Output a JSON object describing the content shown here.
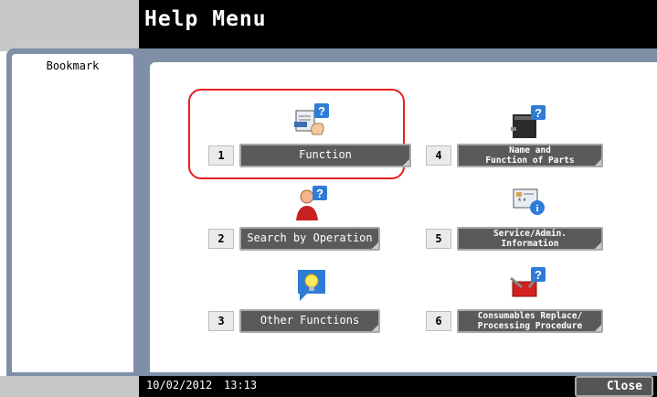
{
  "header": {
    "title": "Help Menu"
  },
  "sidebar": {
    "label": "Bookmark"
  },
  "items": [
    {
      "number": "1",
      "label": "Function",
      "icon": "function-help-icon"
    },
    {
      "number": "2",
      "label": "Search by Operation",
      "icon": "operator-help-icon"
    },
    {
      "number": "3",
      "label": "Other Functions",
      "icon": "lightbulb-help-icon"
    },
    {
      "number": "4",
      "line1": "Name and",
      "line2": "Function of Parts",
      "icon": "printer-help-icon"
    },
    {
      "number": "5",
      "line1": "Service/Admin.",
      "line2": "Information",
      "icon": "info-card-icon"
    },
    {
      "number": "6",
      "line1": "Consumables Replace/",
      "line2": "Processing Procedure",
      "icon": "toolbox-help-icon"
    }
  ],
  "footer": {
    "date": "10/02/2012",
    "time": "13:13",
    "close_label": "Close"
  },
  "colors": {
    "frame": "#7f8fa8",
    "highlight": "#e8201f",
    "header": "#000000"
  }
}
